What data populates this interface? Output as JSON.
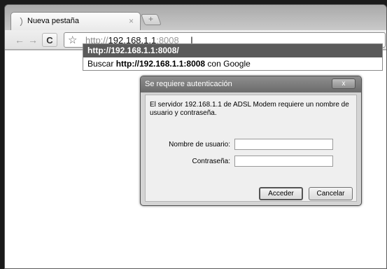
{
  "tab": {
    "title": "Nueva pestaña",
    "close": "×"
  },
  "newtab": {
    "glyph": "+"
  },
  "toolbar": {
    "back": "←",
    "forward": "→",
    "reload": "C",
    "star": "☆"
  },
  "omnibox": {
    "scheme": "http://",
    "host": "192.168.1.1",
    "port": ":8008",
    "caret": "I"
  },
  "dropdown": {
    "selected": "http://192.168.1.1:8008/",
    "search_prefix": "Buscar ",
    "search_query": "http://192.168.1.1:8008",
    "search_suffix": " con Google"
  },
  "dialog": {
    "title": "Se requiere autenticación",
    "close": "x",
    "message": "El servidor 192.168.1.1 de ADSL Modem requiere un nombre de usuario y contraseña.",
    "user_label": "Nombre de usuario:",
    "password_label": "Contraseña:",
    "user_value": "",
    "password_value": "",
    "ok": "Acceder",
    "cancel": "Cancelar"
  }
}
